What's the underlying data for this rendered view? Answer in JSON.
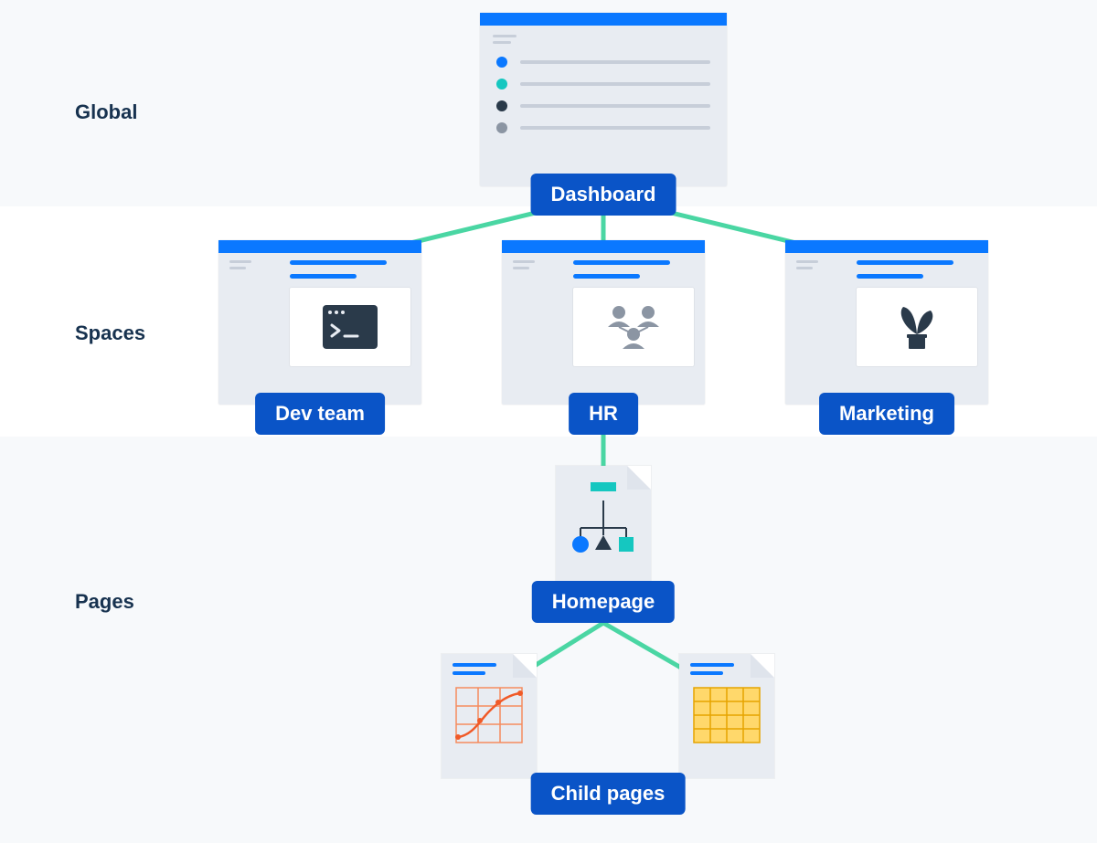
{
  "rows": {
    "global": "Global",
    "spaces": "Spaces",
    "pages": "Pages"
  },
  "nodes": {
    "dashboard": "Dashboard",
    "dev": "Dev team",
    "hr": "HR",
    "marketing": "Marketing",
    "homepage": "Homepage",
    "childpages": "Child pages"
  },
  "colors": {
    "badge_bg": "#0a54c7",
    "titlebar": "#0a78ff",
    "connector": "#4ad6a3",
    "band_bg": "#f7f9fb",
    "label_text": "#17324f"
  },
  "diagram": {
    "type": "tree",
    "levels": [
      {
        "name": "Global",
        "nodes": [
          "Dashboard"
        ]
      },
      {
        "name": "Spaces",
        "nodes": [
          "Dev team",
          "HR",
          "Marketing"
        ],
        "parent_of_all": "Dashboard"
      },
      {
        "name": "Pages",
        "nodes": [
          "Homepage"
        ],
        "parent": "HR"
      },
      {
        "name": "Pages",
        "nodes": [
          "Child pages"
        ],
        "parent": "Homepage",
        "count": 2
      }
    ]
  }
}
